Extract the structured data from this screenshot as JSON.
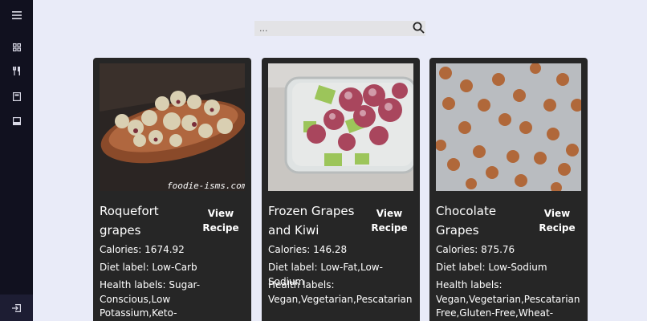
{
  "search": {
    "value": "",
    "placeholder": "..."
  },
  "cards": [
    {
      "title": "Roquefort grapes",
      "view_label": "View Recipe",
      "calories": "Calories: 1674.92",
      "diet": "Diet label: Low-Carb",
      "health": "Health labels: Sugar-Conscious,Low Potassium,Keto-",
      "watermark": "foodie-isms.com"
    },
    {
      "title": "Frozen Grapes and Kiwi",
      "view_label": "View Recipe",
      "calories": "Calories: 146.28",
      "diet": "Diet label: Low-Fat,Low-Sodium",
      "health": "Health labels: Vegan,Vegetarian,Pescatarian"
    },
    {
      "title": "Chocolate Grapes",
      "view_label": "View Recipe",
      "calories": "Calories: 875.76",
      "diet": "Diet label: Low-Sodium",
      "health": "Health labels: Vegan,Vegetarian,Pescatarian Free,Gluten-Free,Wheat-"
    }
  ],
  "icons": {
    "menu": "hamburger-menu-icon",
    "dashboard": "grid-icon",
    "recipes": "utensils-icon",
    "book": "book-icon",
    "saved": "inbox-icon",
    "logout": "logout-icon"
  },
  "colors": {
    "background": "#e9ebf8",
    "sidebar": "#11111f",
    "card": "#262626"
  }
}
